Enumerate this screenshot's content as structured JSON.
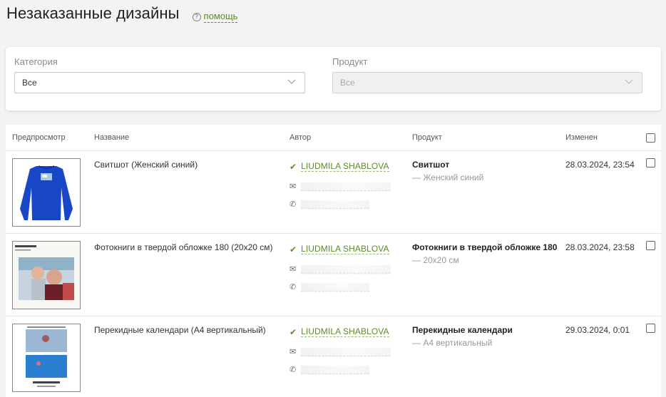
{
  "header": {
    "title": "Незаказанные дизайны",
    "help_icon": "question-circle-icon",
    "help_label": "помощь"
  },
  "filters": {
    "category": {
      "label": "Категория",
      "value": "Все"
    },
    "product": {
      "label": "Продукт",
      "value": "Все",
      "disabled": true
    }
  },
  "table": {
    "columns": [
      "Предпросмотр",
      "Название",
      "Автор",
      "Продукт",
      "Изменен"
    ],
    "rows": [
      {
        "preview": "blue-sweatshirt",
        "name": "Свитшот (Женский синий)",
        "author": "LIUDMILA SHABLOVA",
        "product_main": "Свитшот",
        "product_sub": "— Женский синий",
        "changed": "28.03.2024, 23:54"
      },
      {
        "preview": "photobook",
        "name": "Фотокниги в твердой обложке 180 (20х20 см)",
        "author": "LIUDMILA SHABLOVA",
        "product_main": "Фотокниги в твердой обложке 180",
        "product_sub": "— 20х20 см",
        "changed": "28.03.2024, 23:58"
      },
      {
        "preview": "calendar",
        "name": "Перекидные календари (А4 вертикальный)",
        "author": "LIUDMILA SHABLOVA",
        "product_main": "Перекидные календари",
        "product_sub": "— А4 вертикальный",
        "changed": "29.03.2024, 0:01"
      }
    ]
  },
  "colors": {
    "accent": "#5d8a2a",
    "background": "#f3f3f3"
  }
}
